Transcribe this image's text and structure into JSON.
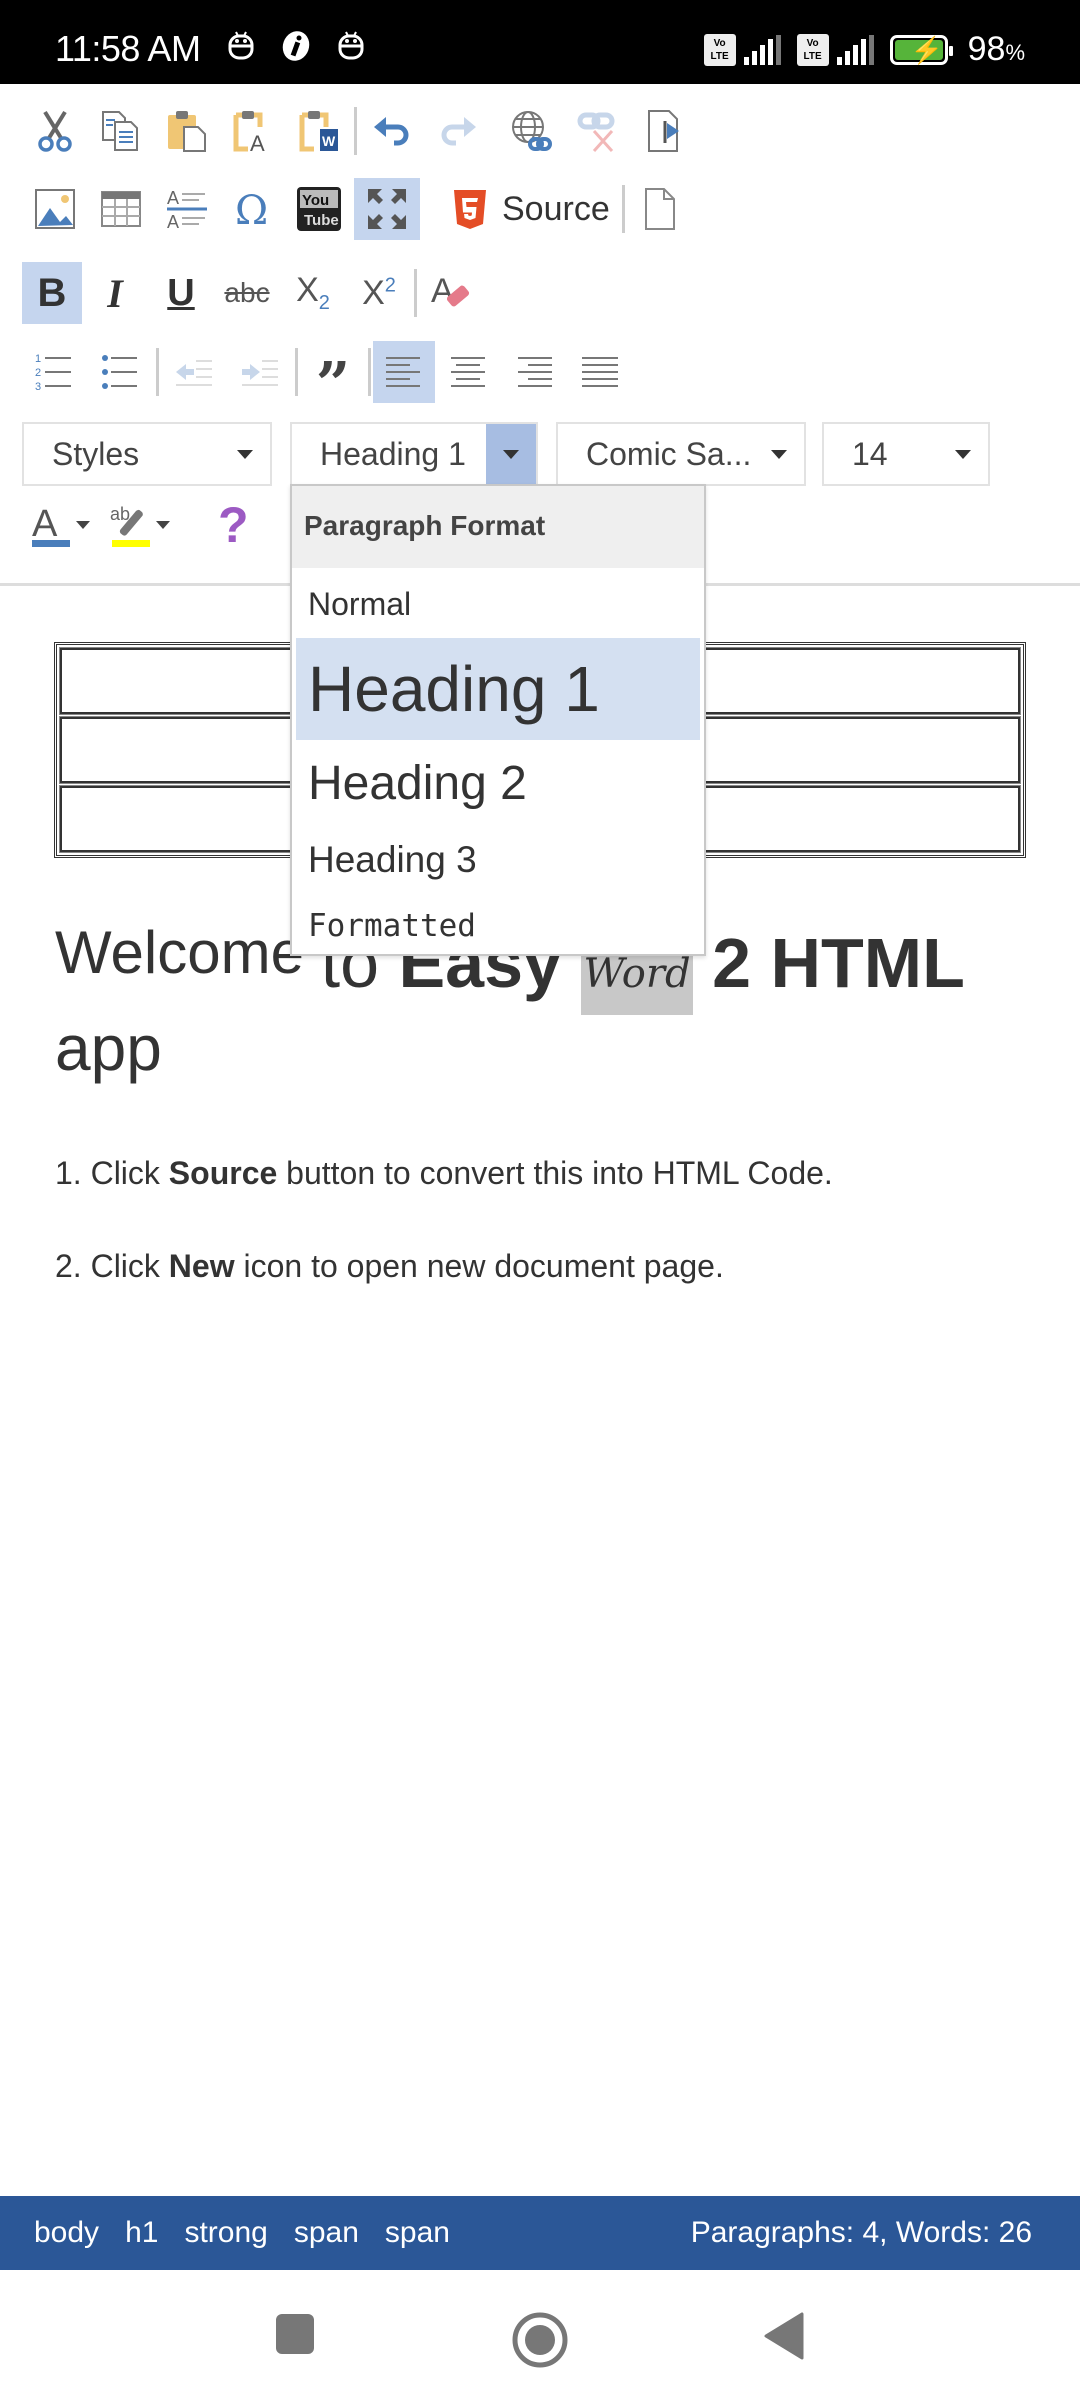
{
  "status_bar": {
    "time": "11:58 AM",
    "left_icons": [
      "robot-notification-icon",
      "info-notification-icon",
      "robot-notification-icon"
    ],
    "sim1": "VoLTE",
    "sim2": "VoLTE",
    "battery_percent": "98",
    "battery_unit": "%",
    "battery_charging": true
  },
  "toolbar": {
    "row1": [
      {
        "name": "cut-icon",
        "label": "Cut"
      },
      {
        "name": "copy-icon",
        "label": "Copy"
      },
      {
        "name": "paste-icon",
        "label": "Paste"
      },
      {
        "name": "paste-text-icon",
        "label": "Paste as plain text"
      },
      {
        "name": "paste-word-icon",
        "label": "Paste from Word"
      },
      {
        "name": "undo-icon",
        "label": "Undo"
      },
      {
        "name": "redo-icon",
        "label": "Redo",
        "disabled": true
      },
      {
        "name": "link-icon",
        "label": "Link"
      },
      {
        "name": "unlink-icon",
        "label": "Unlink",
        "disabled": true
      },
      {
        "name": "anchor-icon",
        "label": "Anchor"
      }
    ],
    "row2": [
      {
        "name": "image-icon",
        "label": "Image"
      },
      {
        "name": "table-icon",
        "label": "Table"
      },
      {
        "name": "horizontal-line-icon",
        "label": "Horizontal Line"
      },
      {
        "name": "special-char-icon",
        "label": "Special Character"
      },
      {
        "name": "youtube-icon",
        "label": "YouTube"
      },
      {
        "name": "maximize-icon",
        "label": "Maximize",
        "active": true
      }
    ],
    "source_label": "Source",
    "new_page_label": "New Page",
    "row3": [
      {
        "name": "bold-icon",
        "glyph": "B",
        "active": true
      },
      {
        "name": "italic-icon",
        "glyph": "I"
      },
      {
        "name": "underline-icon",
        "glyph": "U"
      },
      {
        "name": "strikethrough-icon",
        "glyph": "abc"
      },
      {
        "name": "subscript-icon",
        "glyph": "X",
        "sub": "2"
      },
      {
        "name": "superscript-icon",
        "glyph": "X",
        "sup": "2"
      },
      {
        "name": "remove-format-icon",
        "glyph": "A"
      }
    ],
    "row4": [
      {
        "name": "numbered-list-icon"
      },
      {
        "name": "bulleted-list-icon"
      },
      {
        "name": "outdent-icon",
        "disabled": true
      },
      {
        "name": "indent-icon",
        "disabled": true
      },
      {
        "name": "blockquote-icon"
      },
      {
        "name": "align-left-icon",
        "active": true
      },
      {
        "name": "align-center-icon"
      },
      {
        "name": "align-right-icon"
      },
      {
        "name": "justify-icon"
      }
    ],
    "styles_combo": "Styles",
    "format_combo": "Heading 1",
    "font_combo": "Comic Sa...",
    "size_combo": "14",
    "text_color": "#4a7ebb",
    "bg_color": "#ffff00",
    "help_glyph": "?"
  },
  "format_dropdown": {
    "title": "Paragraph Format",
    "items": [
      {
        "label": "Normal",
        "selected": false
      },
      {
        "label": "Heading 1",
        "selected": true
      },
      {
        "label": "Heading 2",
        "selected": false
      },
      {
        "label": "Heading 3",
        "selected": false
      },
      {
        "label": "Formatted",
        "selected": false
      }
    ]
  },
  "document": {
    "table_rows": 3,
    "heading": {
      "part1": "Welcome ",
      "part2": "to ",
      "part3": "Easy ",
      "part4": "Word",
      "part5": " 2 HTML",
      "part6": " app"
    },
    "para1": {
      "prefix": "1. Click ",
      "bold": "Source",
      "suffix": " button to convert this into HTML Code."
    },
    "para2": {
      "prefix": "2. Click ",
      "bold": "New",
      "suffix": " icon to open new document page."
    }
  },
  "footer": {
    "path": [
      "body",
      "h1",
      "strong",
      "span",
      "span"
    ],
    "counts": "Paragraphs: 4, Words: 26",
    "bg_color": "#2b5797"
  },
  "nav": {
    "recents": "recents-button",
    "home": "home-button",
    "back": "back-button"
  }
}
